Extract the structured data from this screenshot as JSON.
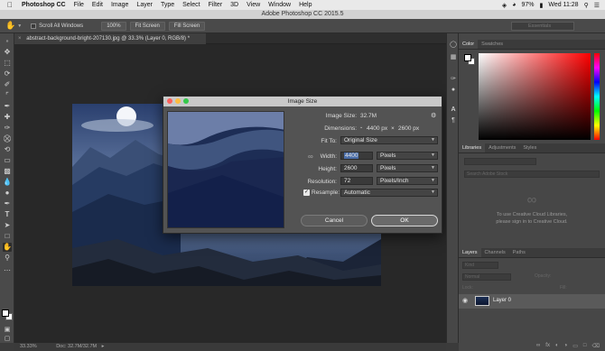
{
  "menubar": {
    "app": "Photoshop CC",
    "items": [
      "File",
      "Edit",
      "Image",
      "Layer",
      "Type",
      "Select",
      "Filter",
      "3D",
      "View",
      "Window",
      "Help"
    ],
    "battery": "97%",
    "clock": "Wed 11:28"
  },
  "window": {
    "title": "Adobe Photoshop CC 2015.5"
  },
  "options": {
    "scroll_all_label": "Scroll All Windows",
    "zoom_100": "100%",
    "fit_screen": "Fit Screen",
    "fill_screen": "Fill Screen",
    "workspace": "Essentials"
  },
  "document": {
    "tab_title": "abstract-background-bright-207130.jpg @ 33.3% (Layer 0, RGB/8) *",
    "zoom": "33.33%",
    "doc_info": "Doc: 32.7M/32.7M"
  },
  "dialog": {
    "title": "Image Size",
    "image_size_label": "Image Size:",
    "image_size_value": "32.7M",
    "dimensions_label": "Dimensions:",
    "dim_width": "4400 px",
    "dim_x": "×",
    "dim_height": "2600 px",
    "fit_to_label": "Fit To:",
    "fit_to_value": "Original Size",
    "width_label": "Width:",
    "width_value": "4400",
    "width_unit": "Pixels",
    "height_label": "Height:",
    "height_value": "2600",
    "height_unit": "Pixels",
    "resolution_label": "Resolution:",
    "resolution_value": "72",
    "resolution_unit": "Pixels/Inch",
    "resample_label": "Resample:",
    "resample_checked": true,
    "resample_value": "Automatic",
    "cancel": "Cancel",
    "ok": "OK"
  },
  "panels": {
    "color_tabs": [
      "Color",
      "Swatches"
    ],
    "library_tabs": [
      "Libraries",
      "Adjustments",
      "Styles"
    ],
    "library_search_placeholder": "Search Adobe Stock",
    "library_msg_1": "To use Creative Cloud Libraries,",
    "library_msg_2": "please sign in to Creative Cloud.",
    "layer_tabs": [
      "Layers",
      "Channels",
      "Paths"
    ],
    "kind_label": "Kind",
    "blend_mode": "Normal",
    "opacity_label": "Opacity:",
    "lock_label": "Lock:",
    "fill_label": "Fill:",
    "layer_name": "Layer 0"
  },
  "colors": {
    "dialog_bg": "#535353",
    "canvas_bg": "#282828",
    "selection": "#4b6ea9"
  }
}
